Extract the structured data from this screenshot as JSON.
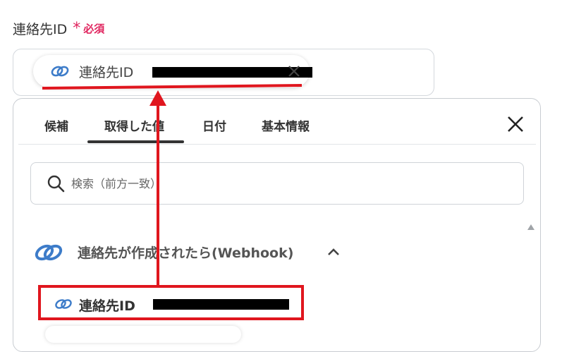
{
  "field": {
    "label": "連絡先ID",
    "asterisk": "*",
    "required": "必須"
  },
  "chip": {
    "label": "連絡先ID",
    "icon": "link-chain-icon",
    "close_icon": "close-icon"
  },
  "tabs": [
    {
      "label": "候補",
      "active": false
    },
    {
      "label": "取得した値",
      "active": true
    },
    {
      "label": "日付",
      "active": false
    },
    {
      "label": "基本情報",
      "active": false
    }
  ],
  "search": {
    "placeholder": "検索（前方一致）",
    "value": ""
  },
  "group": {
    "title": "連絡先が作成されたら(Webhook)",
    "icon": "link-chain-icon",
    "expanded": true
  },
  "items": [
    {
      "label": "連絡先ID",
      "icon": "link-chain-icon",
      "highlighted": true
    }
  ],
  "colors": {
    "accent_blue": "#3d7cc9",
    "highlight_red": "#e0161e",
    "required_pink": "#e0245e",
    "redaction": "#000000"
  }
}
